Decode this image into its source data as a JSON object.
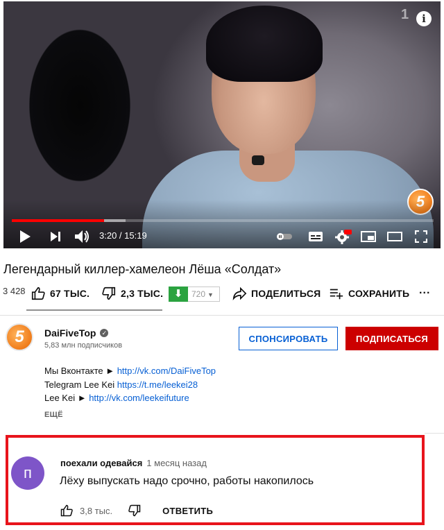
{
  "player": {
    "current_time": "3:20",
    "duration": "15:19",
    "time_separator": " / ",
    "played_fraction": 0.218,
    "buffered_fraction": 0.27,
    "watermark_text": "5",
    "info_label": "i"
  },
  "video": {
    "title": "Легендарный киллер-хамелеон Лёша «Солдат»",
    "views": "3 428",
    "likes": "67 ТЫС.",
    "dislikes": "2,3 ТЫС.",
    "download_quality": "720",
    "share_label": "ПОДЕЛИТЬСЯ",
    "save_label": "СОХРАНИТЬ",
    "more_actions_label": "···"
  },
  "channel": {
    "avatar_text": "5",
    "name": "DaiFiveTop",
    "subscribers": "5,83 млн подписчиков",
    "sponsor_label": "СПОНСИРОВАТЬ",
    "subscribe_label": "ПОДПИСАТЬСЯ"
  },
  "description": {
    "lines": [
      {
        "prefix": "Мы Вконтакте ► ",
        "link": "http://vk.com/DaiFiveTop"
      },
      {
        "prefix": "Telegram Lee Kei ",
        "link": "https://t.me/leekei28"
      },
      {
        "prefix": "Lee Kei ► ",
        "link": "http://vk.com/leekeifuture"
      }
    ],
    "more_label": "ЕЩЁ"
  },
  "comment": {
    "avatar_letter": "п",
    "author": "поехали одевайся",
    "time": "1 месяц назад",
    "text": "Лёху выпускать надо срочно, работы накопилось",
    "likes": "3,8 тыс.",
    "reply_label": "ОТВЕТИТЬ"
  },
  "colors": {
    "accent_red": "#ff0000",
    "subscribe_red": "#cc0000",
    "link_blue": "#065fd4",
    "highlight_frame": "#e8141c",
    "download_green": "#2ba340",
    "comment_avatar": "#7e55c8"
  }
}
